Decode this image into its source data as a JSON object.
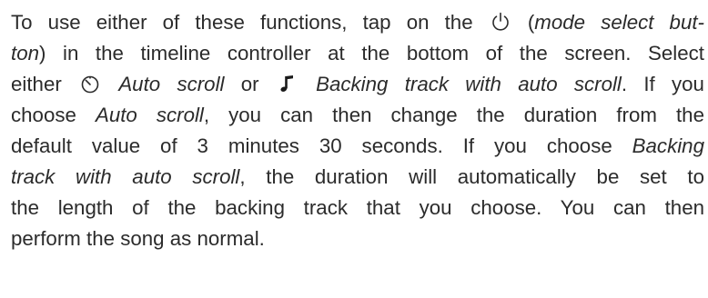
{
  "paragraph": {
    "l1": {
      "a": "To use either of these functions, tap on the",
      "b": "(",
      "c": "mode select but-"
    },
    "l2": {
      "a": "ton",
      "b": ") in the timeline controller at the bottom of the screen. Select"
    },
    "l3": {
      "a": "either",
      "b": "Auto scroll",
      "c": "or",
      "d": "Backing track with auto scroll",
      "e": ". If you"
    },
    "l4": {
      "a": "choose",
      "b": "Auto scroll",
      "c": ", you can then change the duration from the"
    },
    "l5": {
      "a": "default value of 3 minutes 30 seconds. If you choose",
      "b": "Backing"
    },
    "l6": {
      "a": "track with auto scroll",
      "b": ", the duration will automatically be set to"
    },
    "l7": {
      "a": "the length of the backing track that you choose. You can then"
    },
    "l8": {
      "a": "perform the song as normal."
    }
  },
  "icons": {
    "power": "power-icon",
    "timer": "timer-icon",
    "music_note": "music-note-icon"
  }
}
